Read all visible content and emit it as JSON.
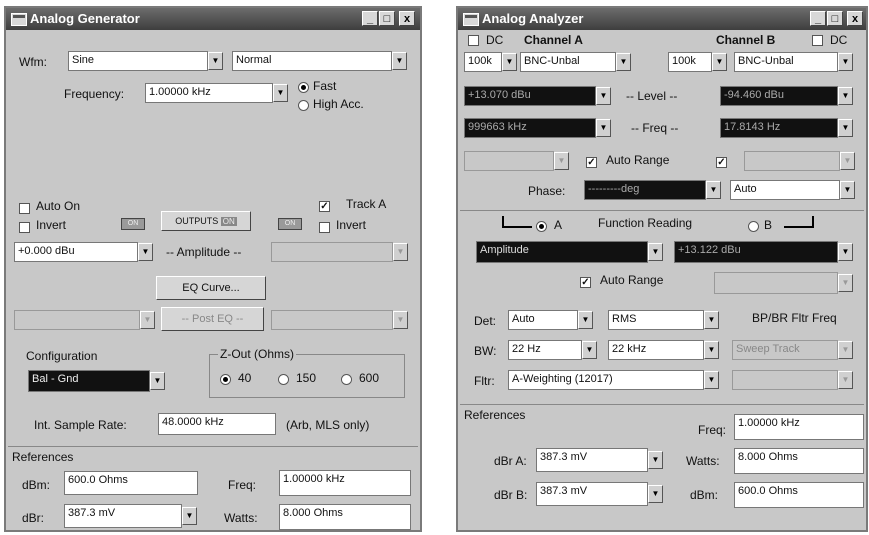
{
  "gen": {
    "title": "Analog Generator",
    "ctrl_min": "_",
    "ctrl_max": "□",
    "ctrl_close": "x",
    "wfm_label": "Wfm:",
    "wfm_value": "Sine",
    "wfm_mode": "Normal",
    "freq_label": "Frequency:",
    "freq_value": "1.00000 kHz",
    "fast": "Fast",
    "high_acc": "High Acc.",
    "auto_on": "Auto On",
    "invert_left": "Invert",
    "track_a": "Track A",
    "invert_right": "Invert",
    "on_a": "ON",
    "on_b": "ON",
    "outputs": "OUTPUTS",
    "outputs_on": "ON",
    "amp_value": "+0.000  dBu",
    "amp_label": "-- Amplitude --",
    "eq_curve": "EQ Curve...",
    "post_eq": "-- Post EQ --",
    "config_label": "Configuration",
    "config_value": "Bal - Gnd",
    "zout_label": "Z-Out (Ohms)",
    "z40": "40",
    "z150": "150",
    "z600": "600",
    "sr_label": "Int. Sample Rate:",
    "sr_value": "48.0000 kHz",
    "sr_note": "(Arb, MLS only)",
    "refs_label": "References",
    "dbm_label": "dBm:",
    "dbm_value": "600.0   Ohms",
    "freq_ref_label": "Freq:",
    "freq_ref_value": "1.00000 kHz",
    "dbr_label": "dBr:",
    "dbr_value": "387.3   mV",
    "watts_label": "Watts:",
    "watts_value": "8.000    Ohms"
  },
  "ana": {
    "title": "Analog Analyzer",
    "ctrl_min": "_",
    "ctrl_max": "□",
    "ctrl_close": "x",
    "dc_a": "DC",
    "channel_a": "Channel A",
    "channel_b": "Channel B",
    "dc_b": "DC",
    "range_a": "100k",
    "input_a": "BNC-Unbal",
    "range_b": "100k",
    "input_b": "BNC-Unbal",
    "level_a": "+13.070  dBu",
    "level_label": "-- Level --",
    "level_b": "-94.460  dBu",
    "freq_a": "999663 kHz",
    "freq_label": "-- Freq --",
    "freq_b": "17.8143  Hz",
    "auto_range": "Auto Range",
    "phase_label": "Phase:",
    "phase_value": "---------deg",
    "phase_mode": "Auto",
    "radio_a": "A",
    "func_reading": "Function Reading",
    "radio_b": "B",
    "func_value": "Amplitude",
    "func_reading_value": "+13.122  dBu",
    "auto_range2": "Auto Range",
    "det_label": "Det:",
    "det_value": "Auto",
    "det_mode": "RMS",
    "bpbr_label": "BP/BR Fltr Freq",
    "bw_label": "BW:",
    "bw_low": "22 Hz",
    "bw_high": "22 kHz",
    "sweep_track": "Sweep Track",
    "fltr_label": "Fltr:",
    "fltr_value": "A-Weighting  (12017)",
    "refs_label": "References",
    "freq_ref_label": "Freq:",
    "freq_ref_value": "1.00000 kHz",
    "dbra_label": "dBr A:",
    "dbra_value": "387.3   mV",
    "watts_label": "Watts:",
    "watts_value": "8.000    Ohms",
    "dbrb_label": "dBr B:",
    "dbrb_value": "387.3   mV",
    "dbm_label": "dBm:",
    "dbm_value": "600.0   Ohms"
  }
}
